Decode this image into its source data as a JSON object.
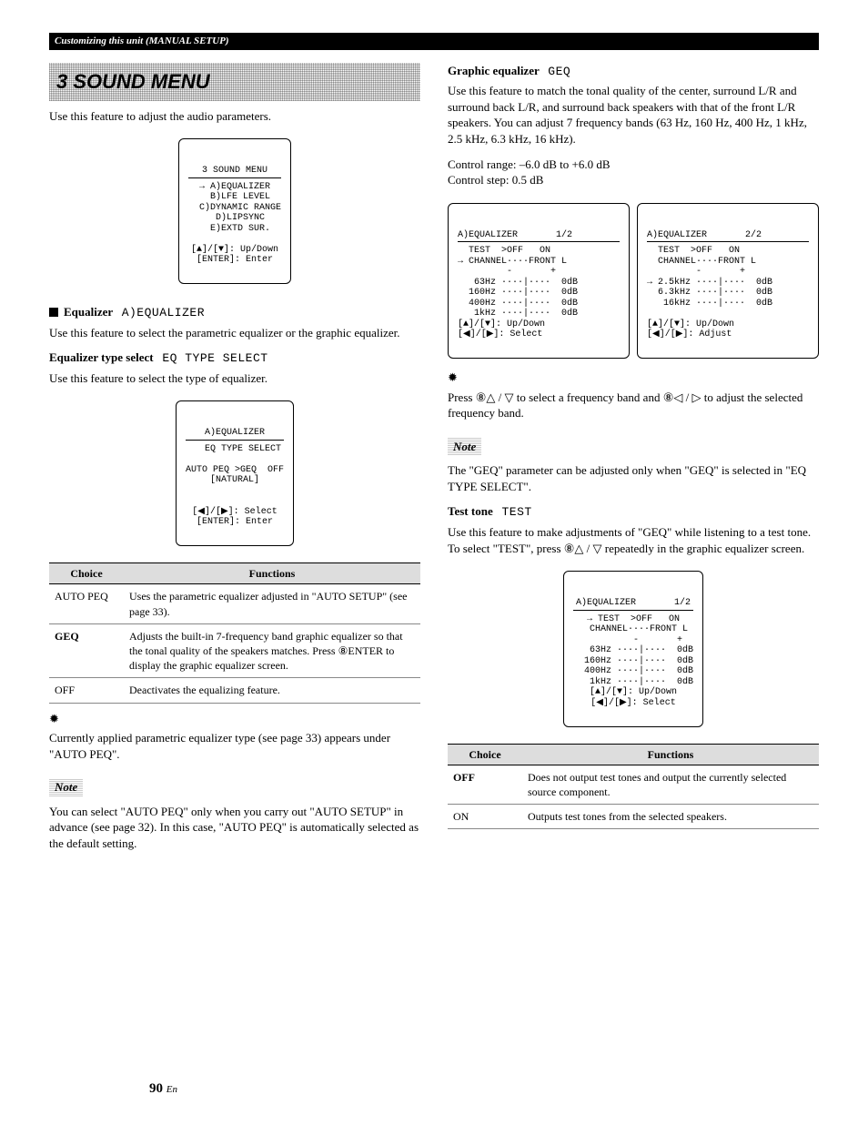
{
  "header": "Customizing this unit (MANUAL SETUP)",
  "banner": "3 SOUND MENU",
  "left": {
    "intro": "Use this feature to adjust the audio parameters.",
    "lcd_main": {
      "title": "3 SOUND MENU",
      "body": "→ A)EQUALIZER\n  B)LFE LEVEL\n  C)DYNAMIC RANGE\n  D)LIPSYNC\n  E)EXTD SUR.\n\n[▲]/[▼]: Up/Down\n[ENTER]: Enter"
    },
    "eq_h": "Equalizer",
    "eq_osd": "A)EQUALIZER",
    "eq_p": "Use this feature to select the parametric equalizer or the graphic equalizer.",
    "eqtype_h": "Equalizer type select",
    "eqtype_osd": "EQ TYPE SELECT",
    "eqtype_p": "Use this feature to select the type of equalizer.",
    "lcd_eqtype": {
      "title": "A)EQUALIZER",
      "body": "   EQ TYPE SELECT\n\nAUTO PEQ >GEQ  OFF\n[NATURAL]\n\n\n[◀]/[▶]: Select\n[ENTER]: Enter"
    },
    "table_h1": "Choice",
    "table_h2": "Functions",
    "rows": [
      {
        "c": "AUTO PEQ",
        "f": "Uses the parametric equalizer adjusted in \"AUTO SETUP\" (see page 33)."
      },
      {
        "c": "GEQ",
        "f": "Adjusts the built-in 7-frequency band graphic equalizer so that the tonal quality of the speakers matches. Press ⑧ENTER to display the graphic equalizer screen.",
        "bold": true
      },
      {
        "c": "OFF",
        "f": "Deactivates the equalizing feature."
      }
    ],
    "tip": "Currently applied parametric equalizer type (see page 33) appears under \"AUTO PEQ\".",
    "note": "You can select \"AUTO PEQ\" only when you carry out \"AUTO SETUP\" in advance (see page 32). In this case, \"AUTO PEQ\" is automatically selected as the default setting.",
    "note_label": "Note"
  },
  "right": {
    "geq_h": "Graphic equalizer",
    "geq_osd": "GEQ",
    "geq_p": "Use this feature to match the tonal quality of the center, surround L/R and surround back L/R, and surround back speakers with that of the front L/R speakers. You can adjust 7 frequency bands (63 Hz, 160 Hz, 400 Hz, 1 kHz, 2.5 kHz, 6.3 kHz, 16 kHz).",
    "geq_range": "Control range: –6.0 dB to +6.0 dB",
    "geq_step": "Control step: 0.5 dB",
    "lcd_geq1": {
      "title": "A)EQUALIZER       1/2",
      "body": "  TEST  >OFF   ON\n→ CHANNEL····FRONT L\n         -       +\n   63Hz ····|····  0dB\n  160Hz ····|····  0dB\n  400Hz ····|····  0dB\n   1kHz ····|····  0dB\n[▲]/[▼]: Up/Down\n[◀]/[▶]: Select"
    },
    "lcd_geq2": {
      "title": "A)EQUALIZER       2/2",
      "body": "  TEST  >OFF   ON\n  CHANNEL····FRONT L\n         -       +\n→ 2.5kHz ····|····  0dB\n  6.3kHz ····|····  0dB\n   16kHz ····|····  0dB\n\n[▲]/[▼]: Up/Down\n[◀]/[▶]: Adjust"
    },
    "tip1": "Press ⑧△ / ▽ to select a frequency band and ⑧◁ / ▷ to adjust the selected frequency band.",
    "note_label": "Note",
    "note1": "The \"GEQ\" parameter can be adjusted only when \"GEQ\" is selected in \"EQ TYPE SELECT\".",
    "tt_h": "Test tone",
    "tt_osd": "TEST",
    "tt_p": "Use this feature to make adjustments of \"GEQ\" while listening to a test tone. To select \"TEST\", press ⑧△ / ▽ repeatedly in the graphic equalizer screen.",
    "lcd_tt": {
      "title": "A)EQUALIZER       1/2",
      "body": "→ TEST  >OFF   ON\n  CHANNEL····FRONT L\n         -       +\n   63Hz ····|····  0dB\n  160Hz ····|····  0dB\n  400Hz ····|····  0dB\n   1kHz ····|····  0dB\n[▲]/[▼]: Up/Down\n[◀]/[▶]: Select"
    },
    "table_h1": "Choice",
    "table_h2": "Functions",
    "rows": [
      {
        "c": "OFF",
        "f": "Does not output test tones and output the currently selected source component.",
        "bold": true
      },
      {
        "c": "ON",
        "f": "Outputs test tones from the selected speakers."
      }
    ]
  },
  "pagenum": "90",
  "pagelang": "En"
}
